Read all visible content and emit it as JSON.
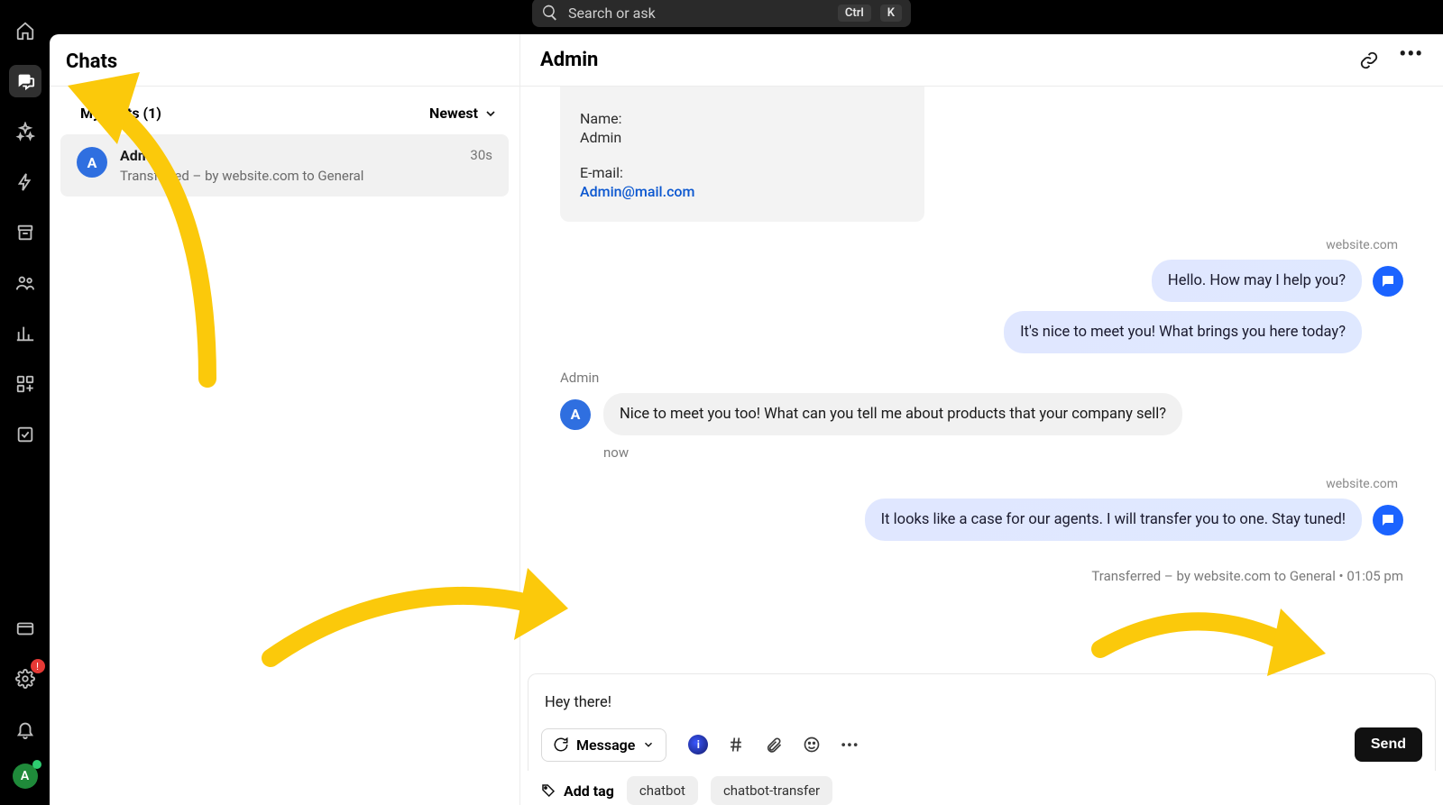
{
  "search": {
    "placeholder": "Search or ask",
    "kbd1": "Ctrl",
    "kbd2": "K"
  },
  "rail": {
    "settings_alert": "!"
  },
  "list": {
    "title": "Chats",
    "my_label": "My chats (1)",
    "sort_label": "Newest",
    "row": {
      "avatar": "A",
      "name": "Admin",
      "subtitle": "Transferred – by website.com to General",
      "time": "30s"
    }
  },
  "conv": {
    "title": "Admin",
    "card": {
      "name_label": "Name:",
      "name_value": "Admin",
      "email_label": "E-mail:",
      "email_value": "Admin@mail.com"
    },
    "src_label": "website.com",
    "bot_msg_1": "Hello. How may I help you?",
    "bot_msg_2": "It's nice to meet you! What brings you here today?",
    "admin_label": "Admin",
    "admin_avatar": "A",
    "admin_msg": "Nice to meet you too! What can you tell me about products that your company sell?",
    "admin_ts": "now",
    "src_label2": "website.com",
    "bot_msg_3": "It looks like a case for our agents. I will transfer you to one. Stay tuned!",
    "transfer_line": "Transferred – by website.com to General • 01:05 pm"
  },
  "composer": {
    "draft": "Hey there!",
    "mode_label": "Message",
    "send_label": "Send"
  },
  "tags": {
    "add_label": "Add tag",
    "tag1": "chatbot",
    "tag2": "chatbot-transfer"
  },
  "avatar_bottom": "A"
}
